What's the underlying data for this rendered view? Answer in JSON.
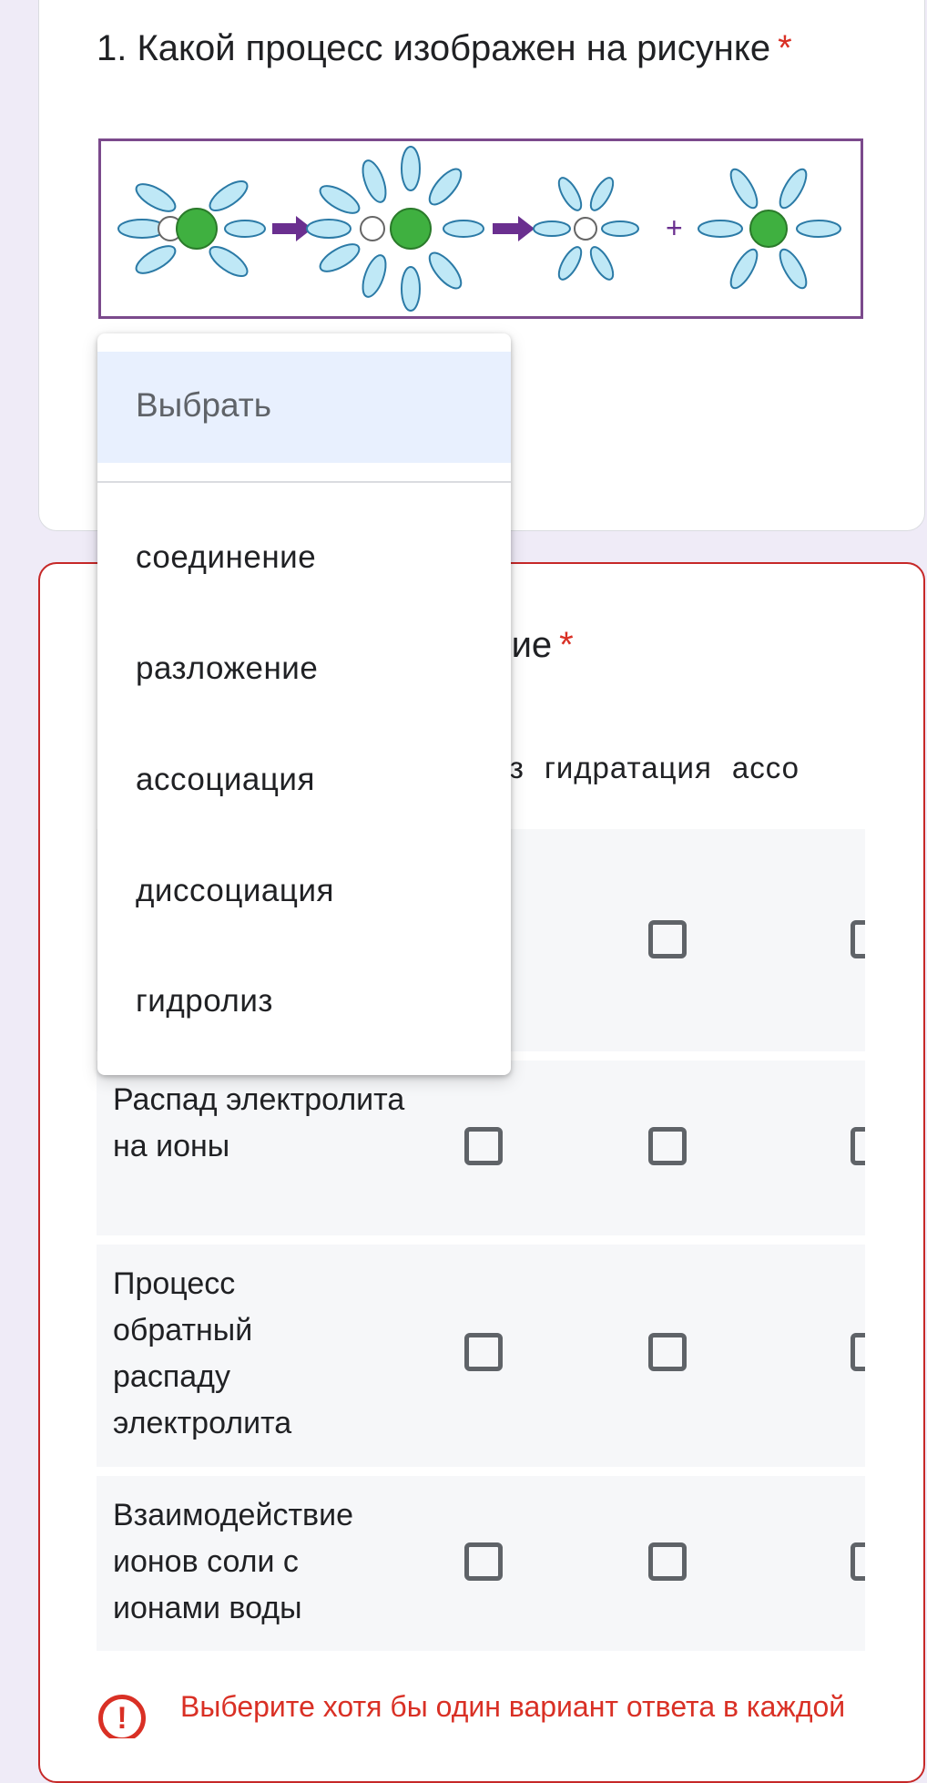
{
  "question1": {
    "title": "1. Какой процесс изображен на рисунке",
    "required_mark": "*"
  },
  "dropdown": {
    "placeholder": "Выбрать",
    "options": [
      "соединение",
      "разложение",
      "ассоциация",
      "диссоциация",
      "гидролиз"
    ]
  },
  "question2": {
    "title_visible_tail": "твие",
    "required_mark": "*",
    "column_headers_visible": [
      "лиз",
      "гидратация",
      "ассо"
    ],
    "rows": [
      {
        "label": ""
      },
      {
        "label": "Распад электролита на ионы"
      },
      {
        "label": "Процесс обратный распаду электролита"
      },
      {
        "label": "Взаимодействие ионов соли с ионами воды"
      }
    ],
    "error": "Выберите хотя бы один вариант ответа в каждой строке"
  },
  "colors": {
    "error": "#d93025",
    "selected_option_bg": "#e8f0fe",
    "page_bg": "#efebf7",
    "image_border": "#7b4a8c"
  }
}
